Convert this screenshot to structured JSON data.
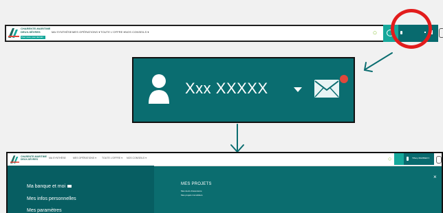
{
  "colors": {
    "brand_dark_teal": "#086a6e",
    "brand_teal": "#0b6d6f",
    "accent_green": "#16a89b",
    "highlight_red": "#e21c1c",
    "badge_red": "#e0473b"
  },
  "icons": [
    "ca-logo",
    "search-icon",
    "chat-icon",
    "user-icon",
    "chevron-down-icon",
    "mail-icon",
    "power-icon",
    "close-icon"
  ],
  "top_header": {
    "logo": {
      "line1": "CHARENTE-MARITIME",
      "line2": "DEUX-SÈVRES",
      "tagline": "Pour vous, pour demain"
    },
    "nav": [
      "MA SYNTHÈSE",
      "MES OPÉRATIONS ▾",
      "TOUTE L'OFFRE ▾",
      "NOS CONSEILS ▾"
    ]
  },
  "zoom": {
    "user_name": "Xxx XXXXX"
  },
  "bottom_screenshot": {
    "logo": {
      "line1": "CHARENTE-MARITIME",
      "line2": "DEUX-SÈVRES"
    },
    "nav": [
      "MA SYNTHÈSE",
      "MES OPÉRATIONS ▾",
      "TOUTE L'OFFRE ▾",
      "NOS CONSEILS ▾"
    ],
    "account_name": "Tiffany BARBIER ▾",
    "sidebar_items": [
      "Ma banque et moi",
      "Mes infos personnelles",
      "Mes paramètres"
    ],
    "projects": {
      "title": "MES PROJETS",
      "links": [
        "Mes devis d'assurance",
        "Mes projets immobiliers"
      ]
    },
    "close_label": "×"
  }
}
